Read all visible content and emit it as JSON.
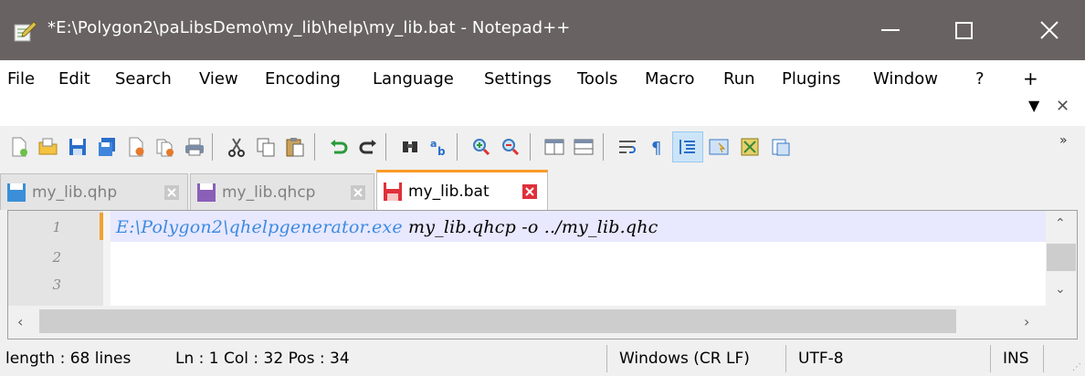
{
  "window": {
    "title": "*E:\\Polygon2\\paLibsDemo\\my_lib\\help\\my_lib.bat - Notepad++"
  },
  "menu": {
    "items": [
      "File",
      "Edit",
      "Search",
      "View",
      "Encoding",
      "Language",
      "Settings",
      "Tools",
      "Macro",
      "Run",
      "Plugins",
      "Window",
      "?"
    ],
    "extra_plus": "+",
    "extra_dropdown": "▼",
    "extra_close": "✕"
  },
  "toolbar": {
    "more": "»",
    "icons": [
      "new-file-icon",
      "open-file-icon",
      "save-icon",
      "save-all-icon",
      "close-icon",
      "close-all-icon",
      "print-icon",
      "cut-icon",
      "copy-icon",
      "paste-icon",
      "undo-icon",
      "redo-icon",
      "find-icon",
      "replace-icon",
      "zoom-in-icon",
      "zoom-out-icon",
      "sync-vertical-icon",
      "sync-horizontal-icon",
      "word-wrap-icon",
      "show-all-chars-icon",
      "indent-guide-icon",
      "doc-map-icon",
      "function-list-icon",
      "folder-workspace-icon"
    ]
  },
  "tabs": [
    {
      "label": "my_lib.qhp",
      "active": false,
      "color": "#3a8fd8"
    },
    {
      "label": "my_lib.qhcp",
      "active": false,
      "color": "#8a5fb8"
    },
    {
      "label": "my_lib.bat",
      "active": true,
      "color": "#e0303a"
    }
  ],
  "editor": {
    "line_numbers": [
      "1",
      "2",
      "3"
    ],
    "line1_command": "E:\\Polygon2\\qhelpgenerator.exe",
    "line1_args": " my_lib.qhcp -o ../my_lib.qhc"
  },
  "status": {
    "length": "length : 68   lines",
    "position": "Ln : 1    Col : 32    Pos : 34",
    "eol": "Windows (CR LF)",
    "encoding": "UTF-8",
    "mode": "INS"
  }
}
